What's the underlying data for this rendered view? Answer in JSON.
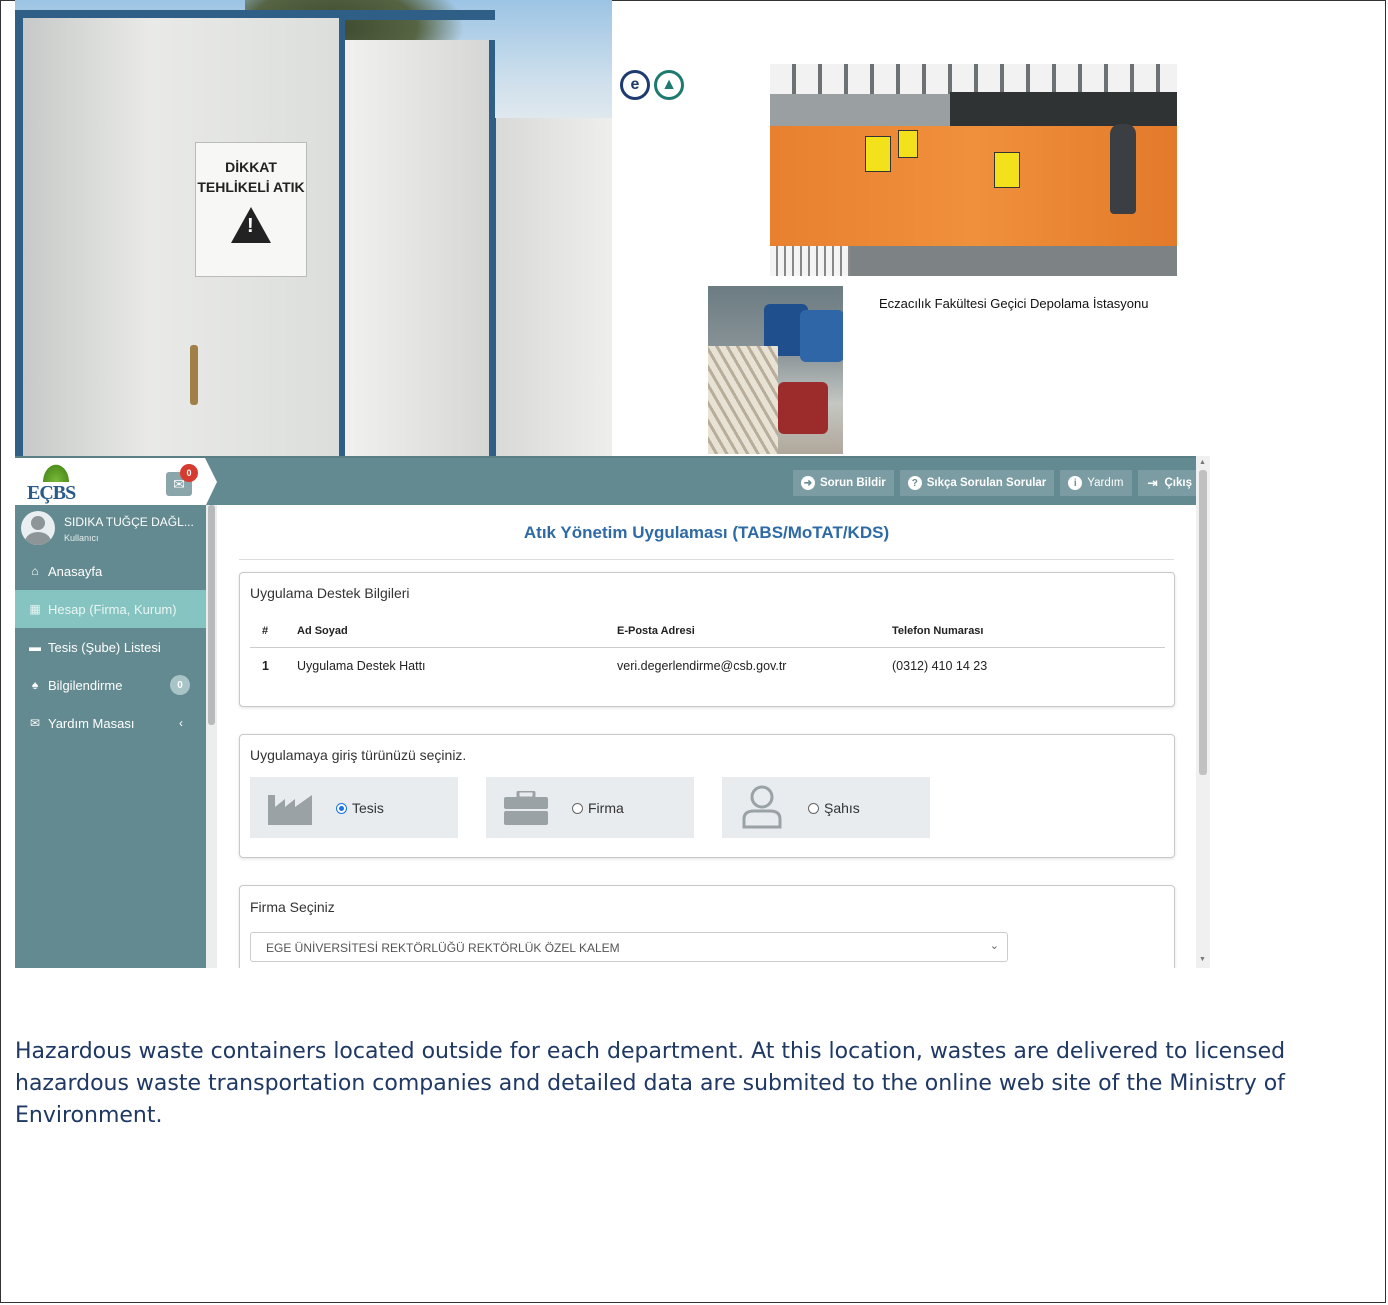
{
  "photos": {
    "sign_text_line1": "DİKKAT",
    "sign_text_line2": "TEHLİKELİ ATIK",
    "caption": "Eczacılık Fakültesi Geçici Depolama İstasyonu"
  },
  "logos": [
    {
      "name": "e-logo",
      "glyph": "e"
    },
    {
      "name": "cap-logo",
      "glyph": "▲"
    }
  ],
  "app": {
    "brand": "EÇBS",
    "mail_count": "0",
    "toolbar": {
      "report": "Sorun Bildir",
      "faq": "Sıkça Sorulan Sorular",
      "help": "Yardım",
      "logout": "Çıkış"
    },
    "user": {
      "name": "SIDIKA TUĞÇE DAĞL...",
      "role": "Kullanıcı"
    },
    "nav": [
      {
        "label": "Anasayfa",
        "icon": "home-icon",
        "glyph": "⌂"
      },
      {
        "label": "Hesap (Firma, Kurum)",
        "icon": "building-icon",
        "glyph": "▦",
        "active": true
      },
      {
        "label": "Tesis (Şube) Listesi",
        "icon": "list-icon",
        "glyph": "▬"
      },
      {
        "label": "Bilgilendirme",
        "icon": "bell-icon",
        "glyph": "♠",
        "count": "0"
      },
      {
        "label": "Yardım Masası",
        "icon": "envelope-icon",
        "glyph": "✉",
        "chevron": "‹"
      }
    ],
    "page_title": "Atık Yönetim Uygulaması (TABS/MoTAT/KDS)",
    "support": {
      "title": "Uygulama Destek Bilgileri",
      "columns": [
        "#",
        "Ad Soyad",
        "E-Posta Adresi",
        "Telefon Numarası"
      ],
      "rows": [
        [
          "1",
          "Uygulama Destek Hattı",
          "veri.degerlendirme@csb.gov.tr",
          "(0312) 410 14 23"
        ]
      ]
    },
    "entry": {
      "title": "Uygulamaya giriş türünüzü seçiniz.",
      "options": [
        {
          "label": "Tesis",
          "icon": "factory-icon",
          "selected": true
        },
        {
          "label": "Firma",
          "icon": "briefcase-icon",
          "selected": false
        },
        {
          "label": "Şahıs",
          "icon": "person-icon",
          "selected": false
        }
      ]
    },
    "company": {
      "title": "Firma Seçiniz",
      "selected": "EGE ÜNİVERSİTESİ REKTÖRLÜĞÜ REKTÖRLÜK ÖZEL KALEM"
    }
  },
  "description": "Hazardous waste containers located outside for each department. At this location, wastes are delivered to licensed hazardous waste transportation companies and detailed data are submited to the online web site of the Ministry of Environment."
}
